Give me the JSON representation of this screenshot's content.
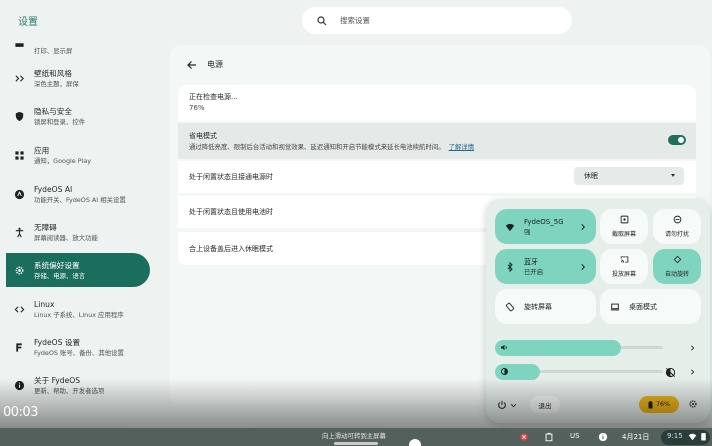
{
  "app": {
    "title": "设置"
  },
  "search": {
    "placeholder": "搜索设置"
  },
  "sidebar": {
    "items": [
      {
        "title": "",
        "subtitle": "打印、显示屏"
      },
      {
        "title": "壁纸和风格",
        "subtitle": "深色主题，屏保"
      },
      {
        "title": "隐私与安全",
        "subtitle": "锁屏和登录、控件"
      },
      {
        "title": "应用",
        "subtitle": "通知，Google Play"
      },
      {
        "title": "FydeOS AI",
        "subtitle": "功能开关、FydeOS AI 相关设置"
      },
      {
        "title": "无障碍",
        "subtitle": "屏幕阅读器、放大功能"
      },
      {
        "title": "系统偏好设置",
        "subtitle": "存储、电源、语言"
      },
      {
        "title": "Linux",
        "subtitle": "Linux 子系统、Linux 应用程序"
      },
      {
        "title": "FydeOS 设置",
        "subtitle": "FydeOS 账号、备份、其他设置"
      },
      {
        "title": "关于 FydeOS",
        "subtitle": "更新、帮助、开发者选项"
      }
    ]
  },
  "main": {
    "title": "电源",
    "status": {
      "line1": "正在检查电源...",
      "line2": "76%"
    },
    "saver": {
      "title": "省电模式",
      "description": "通过降低亮度、限制后台活动和视觉效果、延迟通知和开启节能模式来延长电池续航时间。",
      "link": "了解详情",
      "enabled": true
    },
    "idle_ac": {
      "label": "处于闲置状态且接通电源时",
      "value": "休眠"
    },
    "idle_battery": {
      "label": "处于闲置状态且使用电池时"
    },
    "lid": {
      "label": "合上设备盖后进入休眠模式"
    }
  },
  "quick_settings": {
    "wifi": {
      "name": "FydeOS_5G",
      "status": "强"
    },
    "bluetooth": {
      "name": "蓝牙",
      "status": "已开启"
    },
    "screenshot": "截取屏幕",
    "dnd": "请勿打扰",
    "cast": "投放屏幕",
    "autorotate": "自动旋转",
    "rotate": "旋转屏幕",
    "desktop": "桌面模式",
    "volume_level": 0.75,
    "brightness_level": 0.27,
    "signout": "退出",
    "battery": "76%"
  },
  "video": {
    "timecode": "00:03"
  },
  "shelf": {
    "hint": "向上滑动可转到主屏幕",
    "ime": "US",
    "date": "4月21日",
    "time": "9:15"
  },
  "colors": {
    "accent": "#1b6e5d",
    "tile": "#7fd4c0",
    "battery": "#ebb31a"
  }
}
